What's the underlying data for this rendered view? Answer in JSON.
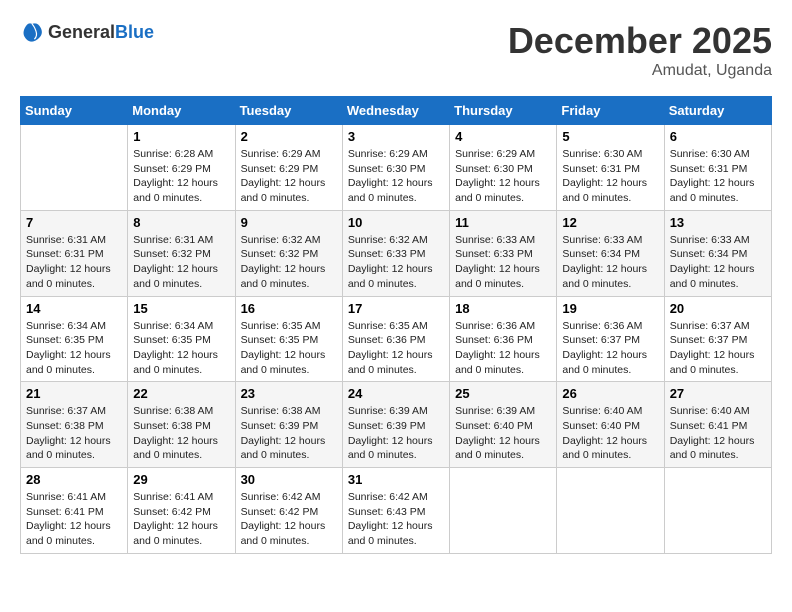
{
  "logo": {
    "general": "General",
    "blue": "Blue"
  },
  "header": {
    "month": "December 2025",
    "location": "Amudat, Uganda"
  },
  "weekdays": [
    "Sunday",
    "Monday",
    "Tuesday",
    "Wednesday",
    "Thursday",
    "Friday",
    "Saturday"
  ],
  "weeks": [
    [
      {
        "day": "",
        "sunrise": "",
        "sunset": "",
        "daylight": ""
      },
      {
        "day": "1",
        "sunrise": "6:28 AM",
        "sunset": "6:29 PM",
        "daylight": "12 hours and 0 minutes."
      },
      {
        "day": "2",
        "sunrise": "6:29 AM",
        "sunset": "6:29 PM",
        "daylight": "12 hours and 0 minutes."
      },
      {
        "day": "3",
        "sunrise": "6:29 AM",
        "sunset": "6:30 PM",
        "daylight": "12 hours and 0 minutes."
      },
      {
        "day": "4",
        "sunrise": "6:29 AM",
        "sunset": "6:30 PM",
        "daylight": "12 hours and 0 minutes."
      },
      {
        "day": "5",
        "sunrise": "6:30 AM",
        "sunset": "6:31 PM",
        "daylight": "12 hours and 0 minutes."
      },
      {
        "day": "6",
        "sunrise": "6:30 AM",
        "sunset": "6:31 PM",
        "daylight": "12 hours and 0 minutes."
      }
    ],
    [
      {
        "day": "7",
        "sunrise": "6:31 AM",
        "sunset": "6:31 PM",
        "daylight": "12 hours and 0 minutes."
      },
      {
        "day": "8",
        "sunrise": "6:31 AM",
        "sunset": "6:32 PM",
        "daylight": "12 hours and 0 minutes."
      },
      {
        "day": "9",
        "sunrise": "6:32 AM",
        "sunset": "6:32 PM",
        "daylight": "12 hours and 0 minutes."
      },
      {
        "day": "10",
        "sunrise": "6:32 AM",
        "sunset": "6:33 PM",
        "daylight": "12 hours and 0 minutes."
      },
      {
        "day": "11",
        "sunrise": "6:33 AM",
        "sunset": "6:33 PM",
        "daylight": "12 hours and 0 minutes."
      },
      {
        "day": "12",
        "sunrise": "6:33 AM",
        "sunset": "6:34 PM",
        "daylight": "12 hours and 0 minutes."
      },
      {
        "day": "13",
        "sunrise": "6:33 AM",
        "sunset": "6:34 PM",
        "daylight": "12 hours and 0 minutes."
      }
    ],
    [
      {
        "day": "14",
        "sunrise": "6:34 AM",
        "sunset": "6:35 PM",
        "daylight": "12 hours and 0 minutes."
      },
      {
        "day": "15",
        "sunrise": "6:34 AM",
        "sunset": "6:35 PM",
        "daylight": "12 hours and 0 minutes."
      },
      {
        "day": "16",
        "sunrise": "6:35 AM",
        "sunset": "6:35 PM",
        "daylight": "12 hours and 0 minutes."
      },
      {
        "day": "17",
        "sunrise": "6:35 AM",
        "sunset": "6:36 PM",
        "daylight": "12 hours and 0 minutes."
      },
      {
        "day": "18",
        "sunrise": "6:36 AM",
        "sunset": "6:36 PM",
        "daylight": "12 hours and 0 minutes."
      },
      {
        "day": "19",
        "sunrise": "6:36 AM",
        "sunset": "6:37 PM",
        "daylight": "12 hours and 0 minutes."
      },
      {
        "day": "20",
        "sunrise": "6:37 AM",
        "sunset": "6:37 PM",
        "daylight": "12 hours and 0 minutes."
      }
    ],
    [
      {
        "day": "21",
        "sunrise": "6:37 AM",
        "sunset": "6:38 PM",
        "daylight": "12 hours and 0 minutes."
      },
      {
        "day": "22",
        "sunrise": "6:38 AM",
        "sunset": "6:38 PM",
        "daylight": "12 hours and 0 minutes."
      },
      {
        "day": "23",
        "sunrise": "6:38 AM",
        "sunset": "6:39 PM",
        "daylight": "12 hours and 0 minutes."
      },
      {
        "day": "24",
        "sunrise": "6:39 AM",
        "sunset": "6:39 PM",
        "daylight": "12 hours and 0 minutes."
      },
      {
        "day": "25",
        "sunrise": "6:39 AM",
        "sunset": "6:40 PM",
        "daylight": "12 hours and 0 minutes."
      },
      {
        "day": "26",
        "sunrise": "6:40 AM",
        "sunset": "6:40 PM",
        "daylight": "12 hours and 0 minutes."
      },
      {
        "day": "27",
        "sunrise": "6:40 AM",
        "sunset": "6:41 PM",
        "daylight": "12 hours and 0 minutes."
      }
    ],
    [
      {
        "day": "28",
        "sunrise": "6:41 AM",
        "sunset": "6:41 PM",
        "daylight": "12 hours and 0 minutes."
      },
      {
        "day": "29",
        "sunrise": "6:41 AM",
        "sunset": "6:42 PM",
        "daylight": "12 hours and 0 minutes."
      },
      {
        "day": "30",
        "sunrise": "6:42 AM",
        "sunset": "6:42 PM",
        "daylight": "12 hours and 0 minutes."
      },
      {
        "day": "31",
        "sunrise": "6:42 AM",
        "sunset": "6:43 PM",
        "daylight": "12 hours and 0 minutes."
      },
      {
        "day": "",
        "sunrise": "",
        "sunset": "",
        "daylight": ""
      },
      {
        "day": "",
        "sunrise": "",
        "sunset": "",
        "daylight": ""
      },
      {
        "day": "",
        "sunrise": "",
        "sunset": "",
        "daylight": ""
      }
    ]
  ],
  "labels": {
    "sunrise": "Sunrise:",
    "sunset": "Sunset:",
    "daylight": "Daylight:"
  }
}
